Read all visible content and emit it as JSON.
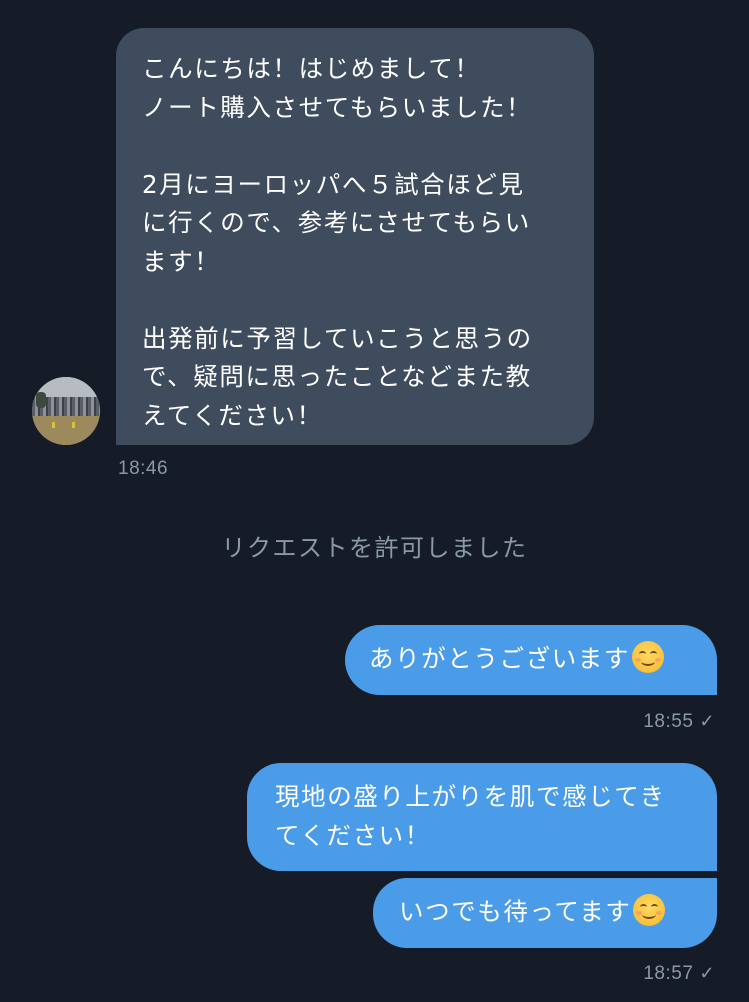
{
  "conversation": {
    "incoming": {
      "text": "こんにちは！はじめまして！\nノート購入させてもらいました！\n\n2月にヨーロッパへ５試合ほど見\nに行くので、参考にさせてもらい\nます！\n\n出発前に予習していこうと思うの\nで、疑問に思ったことなどまた教\nえてください！",
      "time": "18:46"
    },
    "system_message": "リクエストを許可しました",
    "outgoing": [
      {
        "text": "ありがとうございます",
        "emoji": "smiling-face-emoji"
      },
      {
        "text": "現地の盛り上がりを肌で感じてき\nてください！"
      },
      {
        "text": "いつでも待ってます",
        "emoji": "smiling-face-emoji"
      }
    ],
    "times": {
      "reply_1": "18:55",
      "reply_2": "18:57"
    },
    "read_icon": "checkmark-icon",
    "colors": {
      "background": "#151c27",
      "incoming_bubble": "#3f4c5d",
      "outgoing_bubble": "#4b9ce8",
      "meta_text": "#8b98a5"
    }
  }
}
